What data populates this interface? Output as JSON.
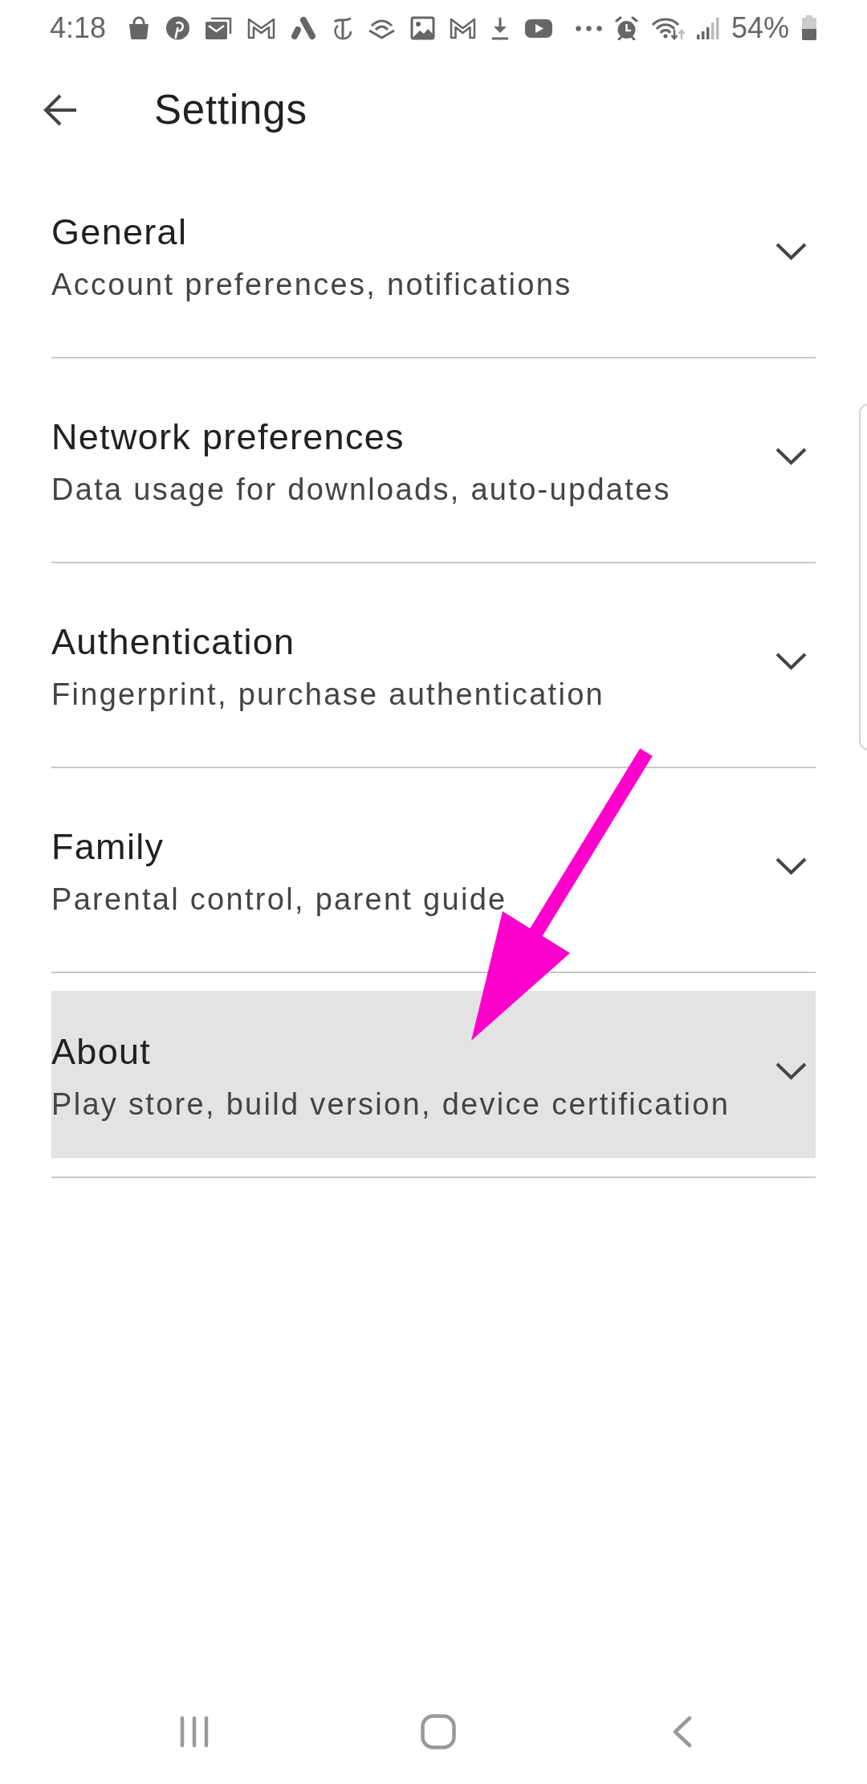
{
  "status_bar": {
    "time": "4:18",
    "battery": "54%"
  },
  "header": {
    "title": "Settings"
  },
  "sections": [
    {
      "title": "General",
      "subtitle": "Account preferences, notifications",
      "selected": false,
      "expanded": false
    },
    {
      "title": "Network preferences",
      "subtitle": "Data usage for downloads, auto-updates",
      "selected": false,
      "expanded": false
    },
    {
      "title": "Authentication",
      "subtitle": "Fingerprint, purchase authentication",
      "selected": false,
      "expanded": false
    },
    {
      "title": "Family",
      "subtitle": "Parental control, parent guide",
      "selected": false,
      "expanded": false
    },
    {
      "title": "About",
      "subtitle": "Play store, build version, device certification",
      "selected": true,
      "expanded": false
    }
  ],
  "annotation": {
    "kind": "arrow"
  }
}
